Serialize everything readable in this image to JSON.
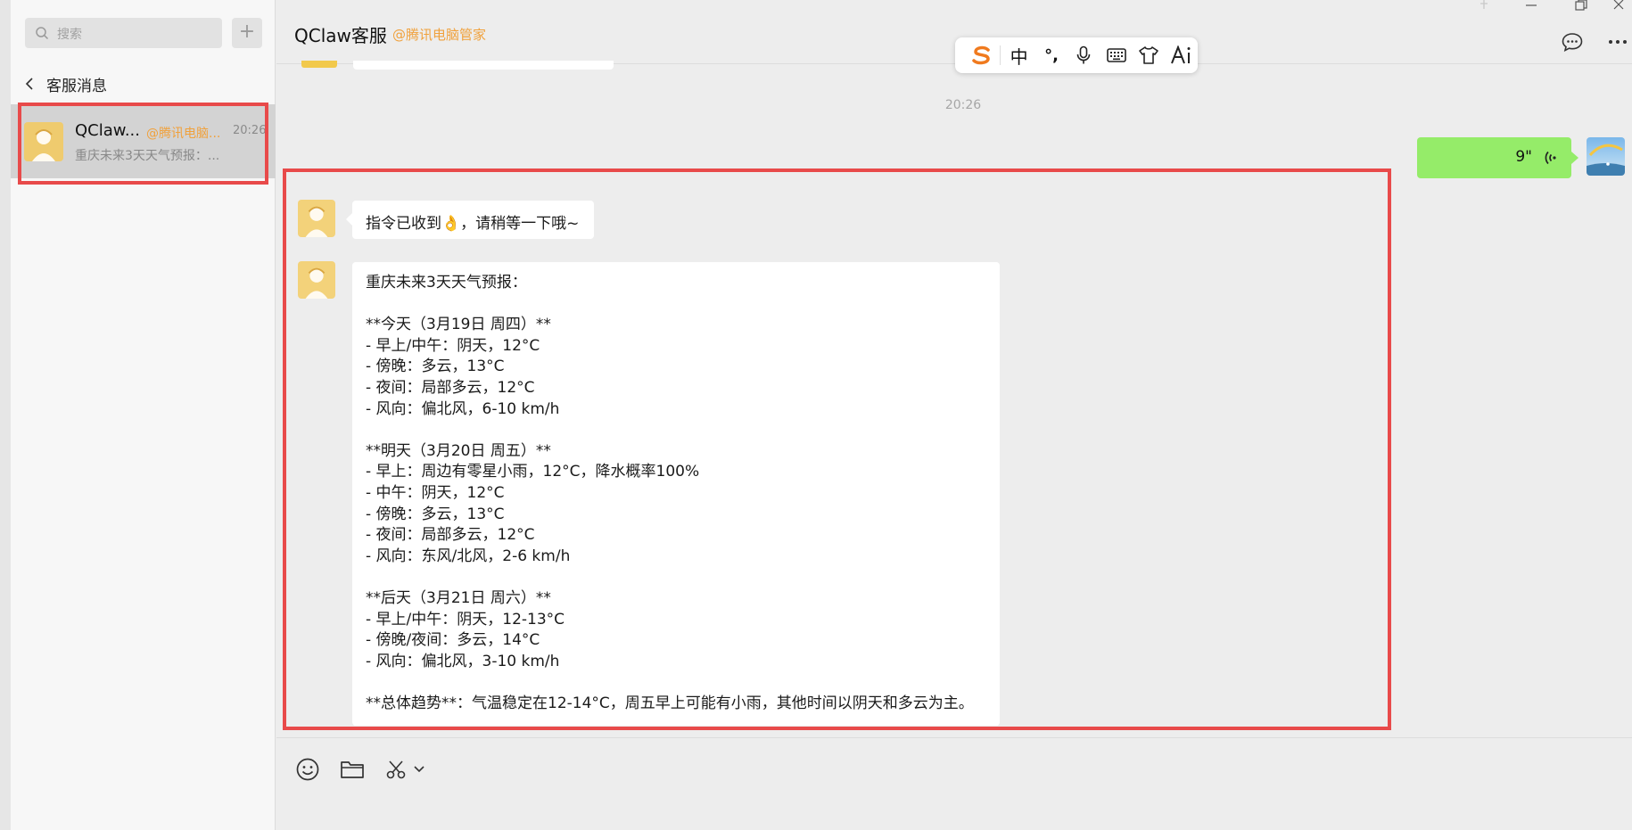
{
  "sidebar": {
    "search_placeholder": "搜索",
    "add_label": "+",
    "back_label": "客服消息",
    "conversation": {
      "name": "QClaw...",
      "tag": "@腾讯电脑...",
      "time": "20:26",
      "preview": "重庆未来3天天气预报：..."
    }
  },
  "header": {
    "title": "QClaw客服",
    "tag": "@腾讯电脑管家"
  },
  "ime": {
    "items": [
      "中",
      "°,"
    ]
  },
  "chat": {
    "time_separator": "20:26",
    "voice_duration": "9\"",
    "msg1": "指令已收到👌，请稍等一下哦~",
    "forecast_lines": [
      "重庆未来3天天气预报：",
      "",
      "**今天（3月19日 周四）**",
      "- 早上/中午：阴天，12°C",
      "- 傍晚：多云，13°C",
      "- 夜间：局部多云，12°C",
      "- 风向：偏北风，6-10 km/h",
      "",
      "**明天（3月20日 周五）**",
      "- 早上：周边有零星小雨，12°C，降水概率100%",
      "- 中午：阴天，12°C",
      "- 傍晚：多云，13°C",
      "- 夜间：局部多云，12°C",
      "- 风向：东风/北风，2-6 km/h",
      "",
      "**后天（3月21日 周六）**",
      "- 早上/中午：阴天，12-13°C",
      "- 傍晚/夜间：多云，14°C",
      "- 风向：偏北风，3-10 km/h",
      "",
      "**总体趋势**：气温稳定在12-14°C，周五早上可能有小雨，其他时间以阴天和多云为主。"
    ]
  },
  "colors": {
    "accent_tag": "#f0a13c",
    "voice_bubble": "#95ec69",
    "highlight": "#e84a4a",
    "selected_item": "#d3d3d3"
  }
}
